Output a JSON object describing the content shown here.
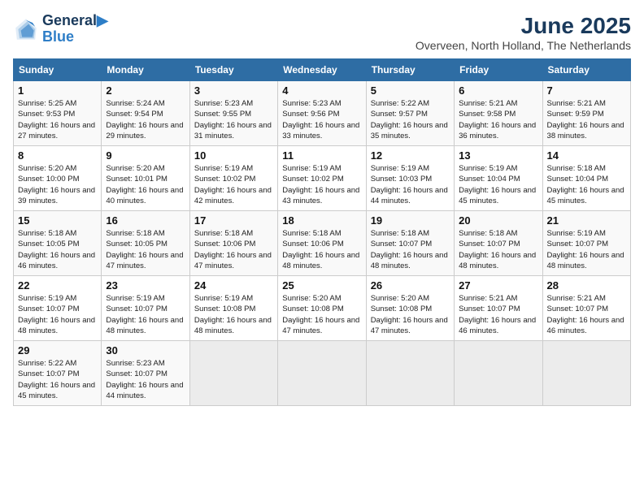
{
  "header": {
    "logo_line1": "General",
    "logo_line2": "Blue",
    "month": "June 2025",
    "location": "Overveen, North Holland, The Netherlands"
  },
  "days_of_week": [
    "Sunday",
    "Monday",
    "Tuesday",
    "Wednesday",
    "Thursday",
    "Friday",
    "Saturday"
  ],
  "weeks": [
    [
      {
        "day": 1,
        "sunrise": "5:25 AM",
        "sunset": "9:53 PM",
        "daylight": "16 hours and 27 minutes."
      },
      {
        "day": 2,
        "sunrise": "5:24 AM",
        "sunset": "9:54 PM",
        "daylight": "16 hours and 29 minutes."
      },
      {
        "day": 3,
        "sunrise": "5:23 AM",
        "sunset": "9:55 PM",
        "daylight": "16 hours and 31 minutes."
      },
      {
        "day": 4,
        "sunrise": "5:23 AM",
        "sunset": "9:56 PM",
        "daylight": "16 hours and 33 minutes."
      },
      {
        "day": 5,
        "sunrise": "5:22 AM",
        "sunset": "9:57 PM",
        "daylight": "16 hours and 35 minutes."
      },
      {
        "day": 6,
        "sunrise": "5:21 AM",
        "sunset": "9:58 PM",
        "daylight": "16 hours and 36 minutes."
      },
      {
        "day": 7,
        "sunrise": "5:21 AM",
        "sunset": "9:59 PM",
        "daylight": "16 hours and 38 minutes."
      }
    ],
    [
      {
        "day": 8,
        "sunrise": "5:20 AM",
        "sunset": "10:00 PM",
        "daylight": "16 hours and 39 minutes."
      },
      {
        "day": 9,
        "sunrise": "5:20 AM",
        "sunset": "10:01 PM",
        "daylight": "16 hours and 40 minutes."
      },
      {
        "day": 10,
        "sunrise": "5:19 AM",
        "sunset": "10:02 PM",
        "daylight": "16 hours and 42 minutes."
      },
      {
        "day": 11,
        "sunrise": "5:19 AM",
        "sunset": "10:02 PM",
        "daylight": "16 hours and 43 minutes."
      },
      {
        "day": 12,
        "sunrise": "5:19 AM",
        "sunset": "10:03 PM",
        "daylight": "16 hours and 44 minutes."
      },
      {
        "day": 13,
        "sunrise": "5:19 AM",
        "sunset": "10:04 PM",
        "daylight": "16 hours and 45 minutes."
      },
      {
        "day": 14,
        "sunrise": "5:18 AM",
        "sunset": "10:04 PM",
        "daylight": "16 hours and 45 minutes."
      }
    ],
    [
      {
        "day": 15,
        "sunrise": "5:18 AM",
        "sunset": "10:05 PM",
        "daylight": "16 hours and 46 minutes."
      },
      {
        "day": 16,
        "sunrise": "5:18 AM",
        "sunset": "10:05 PM",
        "daylight": "16 hours and 47 minutes."
      },
      {
        "day": 17,
        "sunrise": "5:18 AM",
        "sunset": "10:06 PM",
        "daylight": "16 hours and 47 minutes."
      },
      {
        "day": 18,
        "sunrise": "5:18 AM",
        "sunset": "10:06 PM",
        "daylight": "16 hours and 48 minutes."
      },
      {
        "day": 19,
        "sunrise": "5:18 AM",
        "sunset": "10:07 PM",
        "daylight": "16 hours and 48 minutes."
      },
      {
        "day": 20,
        "sunrise": "5:18 AM",
        "sunset": "10:07 PM",
        "daylight": "16 hours and 48 minutes."
      },
      {
        "day": 21,
        "sunrise": "5:19 AM",
        "sunset": "10:07 PM",
        "daylight": "16 hours and 48 minutes."
      }
    ],
    [
      {
        "day": 22,
        "sunrise": "5:19 AM",
        "sunset": "10:07 PM",
        "daylight": "16 hours and 48 minutes."
      },
      {
        "day": 23,
        "sunrise": "5:19 AM",
        "sunset": "10:07 PM",
        "daylight": "16 hours and 48 minutes."
      },
      {
        "day": 24,
        "sunrise": "5:19 AM",
        "sunset": "10:08 PM",
        "daylight": "16 hours and 48 minutes."
      },
      {
        "day": 25,
        "sunrise": "5:20 AM",
        "sunset": "10:08 PM",
        "daylight": "16 hours and 47 minutes."
      },
      {
        "day": 26,
        "sunrise": "5:20 AM",
        "sunset": "10:08 PM",
        "daylight": "16 hours and 47 minutes."
      },
      {
        "day": 27,
        "sunrise": "5:21 AM",
        "sunset": "10:07 PM",
        "daylight": "16 hours and 46 minutes."
      },
      {
        "day": 28,
        "sunrise": "5:21 AM",
        "sunset": "10:07 PM",
        "daylight": "16 hours and 46 minutes."
      }
    ],
    [
      {
        "day": 29,
        "sunrise": "5:22 AM",
        "sunset": "10:07 PM",
        "daylight": "16 hours and 45 minutes."
      },
      {
        "day": 30,
        "sunrise": "5:23 AM",
        "sunset": "10:07 PM",
        "daylight": "16 hours and 44 minutes."
      },
      null,
      null,
      null,
      null,
      null
    ]
  ],
  "labels": {
    "sunrise": "Sunrise:",
    "sunset": "Sunset:",
    "daylight": "Daylight:"
  }
}
